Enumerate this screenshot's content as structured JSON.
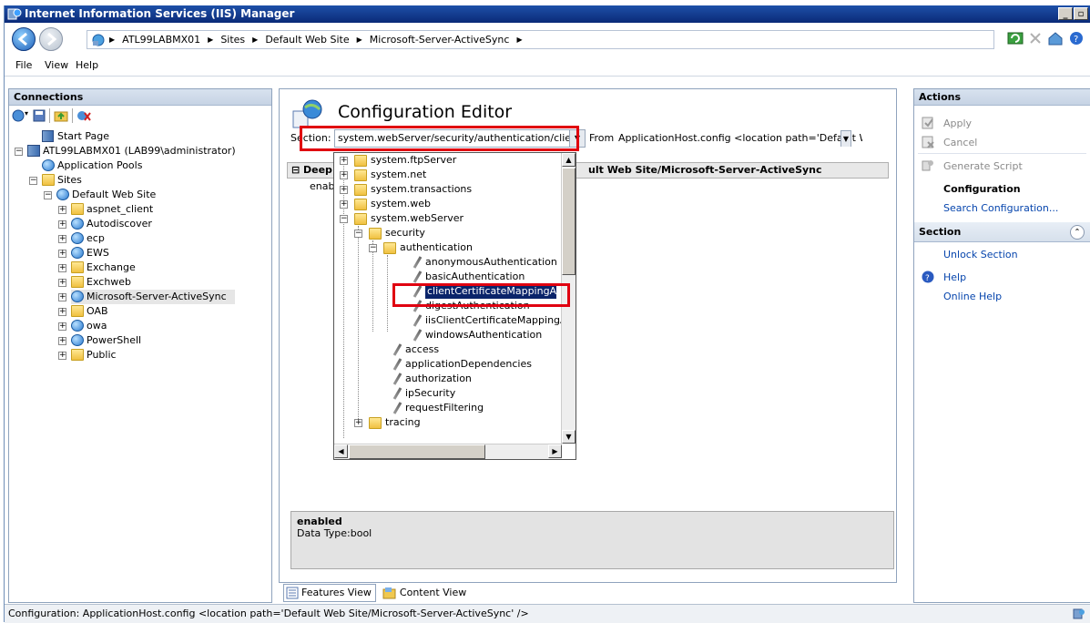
{
  "window": {
    "title": "Internet Information Services (IIS) Manager",
    "min_label": "_",
    "max_label": "▫",
    "close_label": "x"
  },
  "address": {
    "crumbs": [
      "ATL99LABMX01",
      "Sites",
      "Default Web Site",
      "Microsoft-Server-ActiveSync"
    ]
  },
  "menu": {
    "file": "File",
    "view": "View",
    "help": "Help"
  },
  "connections": {
    "header": "Connections",
    "tree": {
      "start_page": "Start Page",
      "server": "ATL99LABMX01 (LAB99\\administrator)",
      "app_pools": "Application Pools",
      "sites": "Sites",
      "default_site": "Default Web Site",
      "children": [
        "aspnet_client",
        "Autodiscover",
        "ecp",
        "EWS",
        "Exchange",
        "Exchweb",
        "Microsoft-Server-ActiveSync",
        "OAB",
        "owa",
        "PowerShell",
        "Public"
      ],
      "selected": "Microsoft-Server-ActiveSync"
    }
  },
  "editor": {
    "title": "Configuration Editor",
    "section_label": "Section:",
    "section_value": "system.webServer/security/authentication/client",
    "from_label": "From:",
    "from_value": "ApplicationHost.config <location path='Default W",
    "grid_header_left": "Deep",
    "grid_header_right": "ult Web Site/Microsoft-Server-ActiveSync",
    "grid_row_left": "enabl",
    "detail_title": "enabled",
    "detail_type": "Data Type:bool"
  },
  "dropdown": {
    "items": {
      "ftp": "system.ftpServer",
      "net": "system.net",
      "transactions": "system.transactions",
      "web": "system.web",
      "webserver": "system.webServer",
      "security": "security",
      "authentication": "authentication",
      "anon": "anonymousAuthentication",
      "basic": "basicAuthentication",
      "clientcert": "clientCertificateMappingAuthe",
      "digest": "digestAuthentication",
      "iiscert": "iisClientCertificateMappingAu",
      "windows": "windowsAuthentication",
      "access": "access",
      "appdeps": "applicationDependencies",
      "authorization": "authorization",
      "ipsecurity": "ipSecurity",
      "reqfilter": "requestFiltering",
      "tracing": "tracing"
    },
    "selected": "clientCertificateMappingAuthe"
  },
  "tabs": {
    "features": "Features View",
    "content": "Content View"
  },
  "actions": {
    "header": "Actions",
    "apply": "Apply",
    "cancel": "Cancel",
    "generate": "Generate Script",
    "configuration_heading": "Configuration",
    "search_config": "Search Configuration...",
    "section_header": "Section",
    "unlock": "Unlock Section",
    "help": "Help",
    "online_help": "Online Help"
  },
  "status": {
    "text": "Configuration: ApplicationHost.config <location path='Default Web Site/Microsoft-Server-ActiveSync' />"
  },
  "colors": {
    "highlight": "#e00010",
    "title_bar": "#1e50a8",
    "selection": "#0a246a"
  }
}
